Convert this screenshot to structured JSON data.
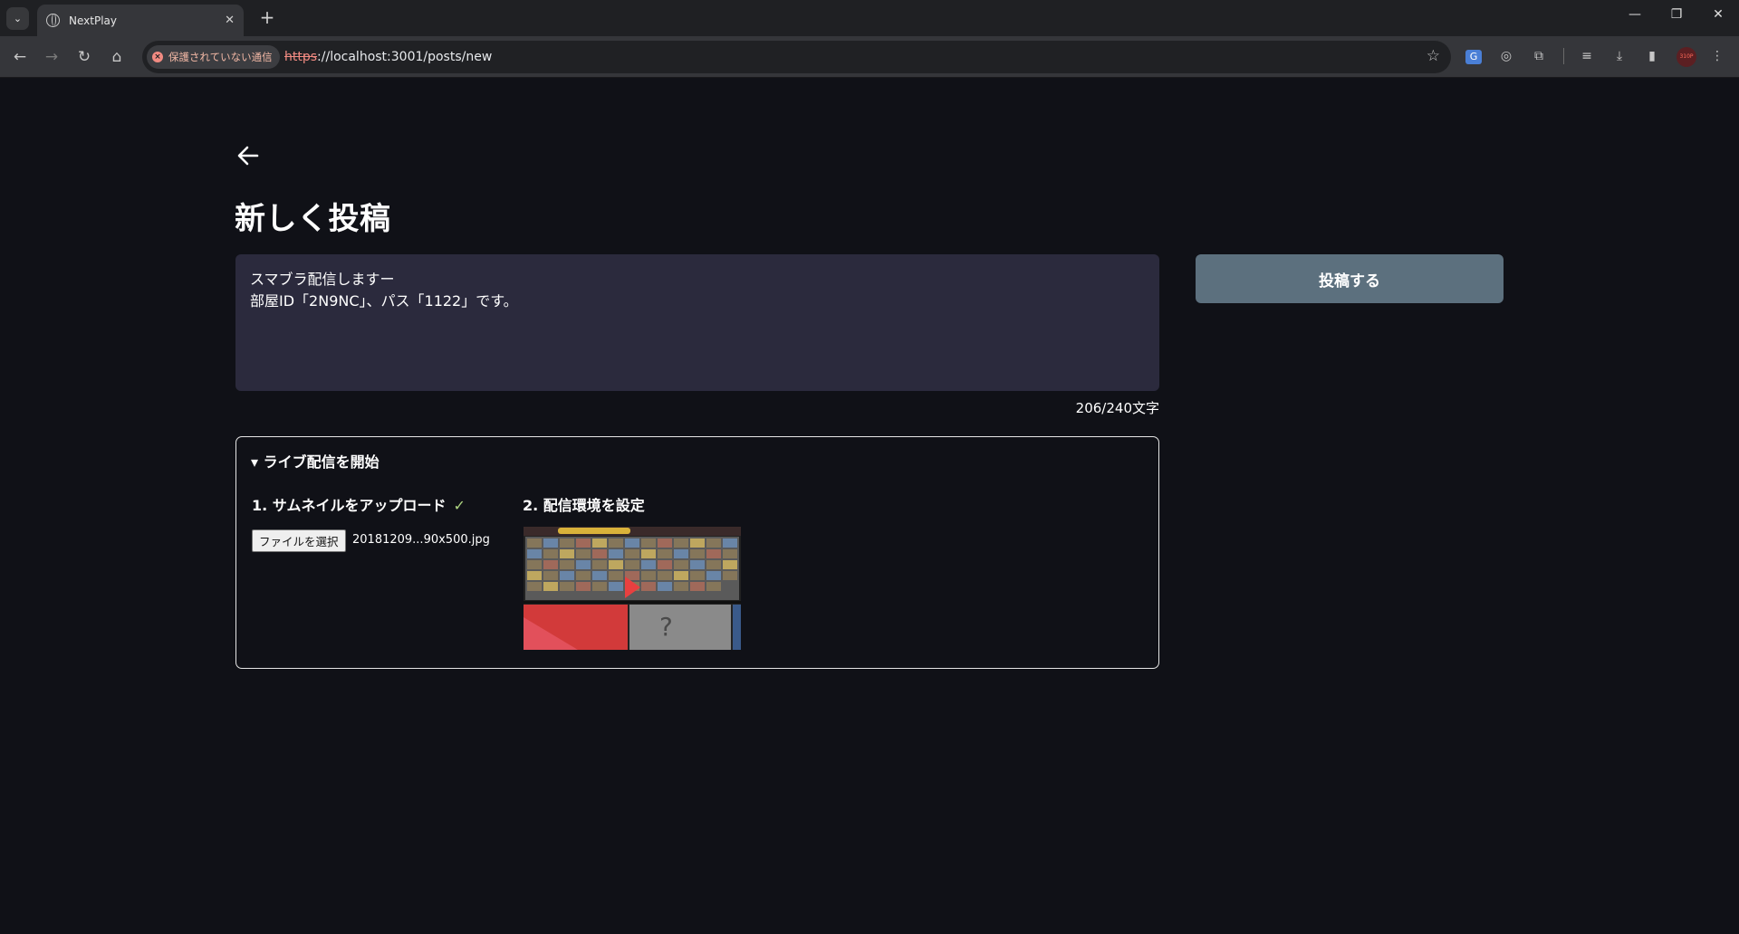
{
  "browser": {
    "tab_title": "NextPlay",
    "security_label": "保護されていない通信",
    "url_scheme": "https",
    "url_rest": "://localhost:3001/posts/new",
    "profile_label": "310P"
  },
  "page": {
    "title": "新しく投稿",
    "post_text": "スマブラ配信しますー\n部屋ID「2N9NC」、パス「1122」です。",
    "char_count": "206/240文字",
    "submit_label": "投稿する",
    "live": {
      "summary": "▾ ライブ配信を開始",
      "step1_label": "1.  サムネイルをアップロード",
      "step1_check": "✓",
      "step2_label": "2.  配信環境を設定",
      "file_button_label": "ファイルを選択",
      "file_name": "20181209...90x500.jpg"
    }
  },
  "colors": {
    "page_bg": "#101117",
    "textarea_bg": "#2b2a3d",
    "submit_bg": "#5c707e",
    "check": "#aed581"
  }
}
